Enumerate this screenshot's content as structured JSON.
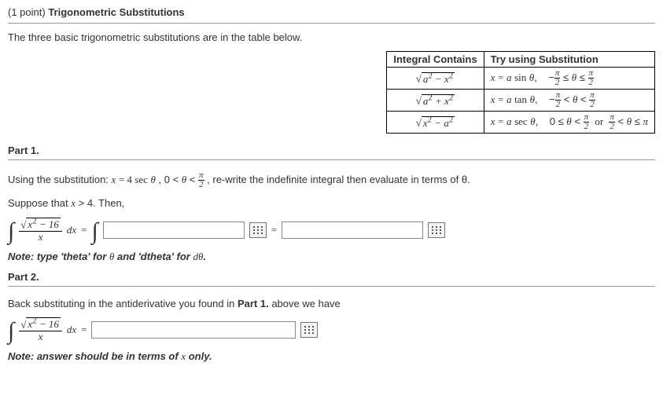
{
  "header": {
    "points": "(1 point)",
    "title": "Trigonometric Substitutions"
  },
  "intro": "The three basic trigonometric substitutions are in the table below.",
  "table": {
    "col1": "Integral Contains",
    "col2": "Try using Substitution",
    "rows": [
      {
        "contains_tex": "√(a² − x²)",
        "sub_tex": "x = a sin θ,",
        "range_tex": "−π/2 ≤ θ ≤ π/2"
      },
      {
        "contains_tex": "√(a² + x²)",
        "sub_tex": "x = a tan θ,",
        "range_tex": "−π/2 < θ < π/2"
      },
      {
        "contains_tex": "√(x² − a²)",
        "sub_tex": "x = a sec θ,",
        "range_tex": "0 ≤ θ < π/2  or  π/2 < θ ≤ π"
      }
    ]
  },
  "part1": {
    "label": "Part 1.",
    "instr_prefix": "Using the substitution: ",
    "sub_eq": "x = 4 sec θ , 0 < θ < ",
    "instr_suffix": ", re-write the indefinite integral then evaluate in terms of θ.",
    "suppose": "Suppose that x > 4. Then,",
    "integral_num": "√(x² − 16)",
    "integral_den": "x",
    "dx": "dx",
    "eq": "=",
    "note_a": "Note: type 'theta' for ",
    "note_b": " and 'dtheta' for ",
    "note_c": "."
  },
  "part2": {
    "label": "Part 2.",
    "instr_a": "Back substituting in the antiderivative you found in ",
    "instr_bold": "Part 1.",
    "instr_b": " above we have",
    "note_a": "Note: answer should be in terms of ",
    "note_b": " only."
  },
  "inputs": {
    "p1a_placeholder": "",
    "p1b_placeholder": "",
    "p2_placeholder": ""
  },
  "icons": {
    "keypad": "keypad-icon"
  }
}
